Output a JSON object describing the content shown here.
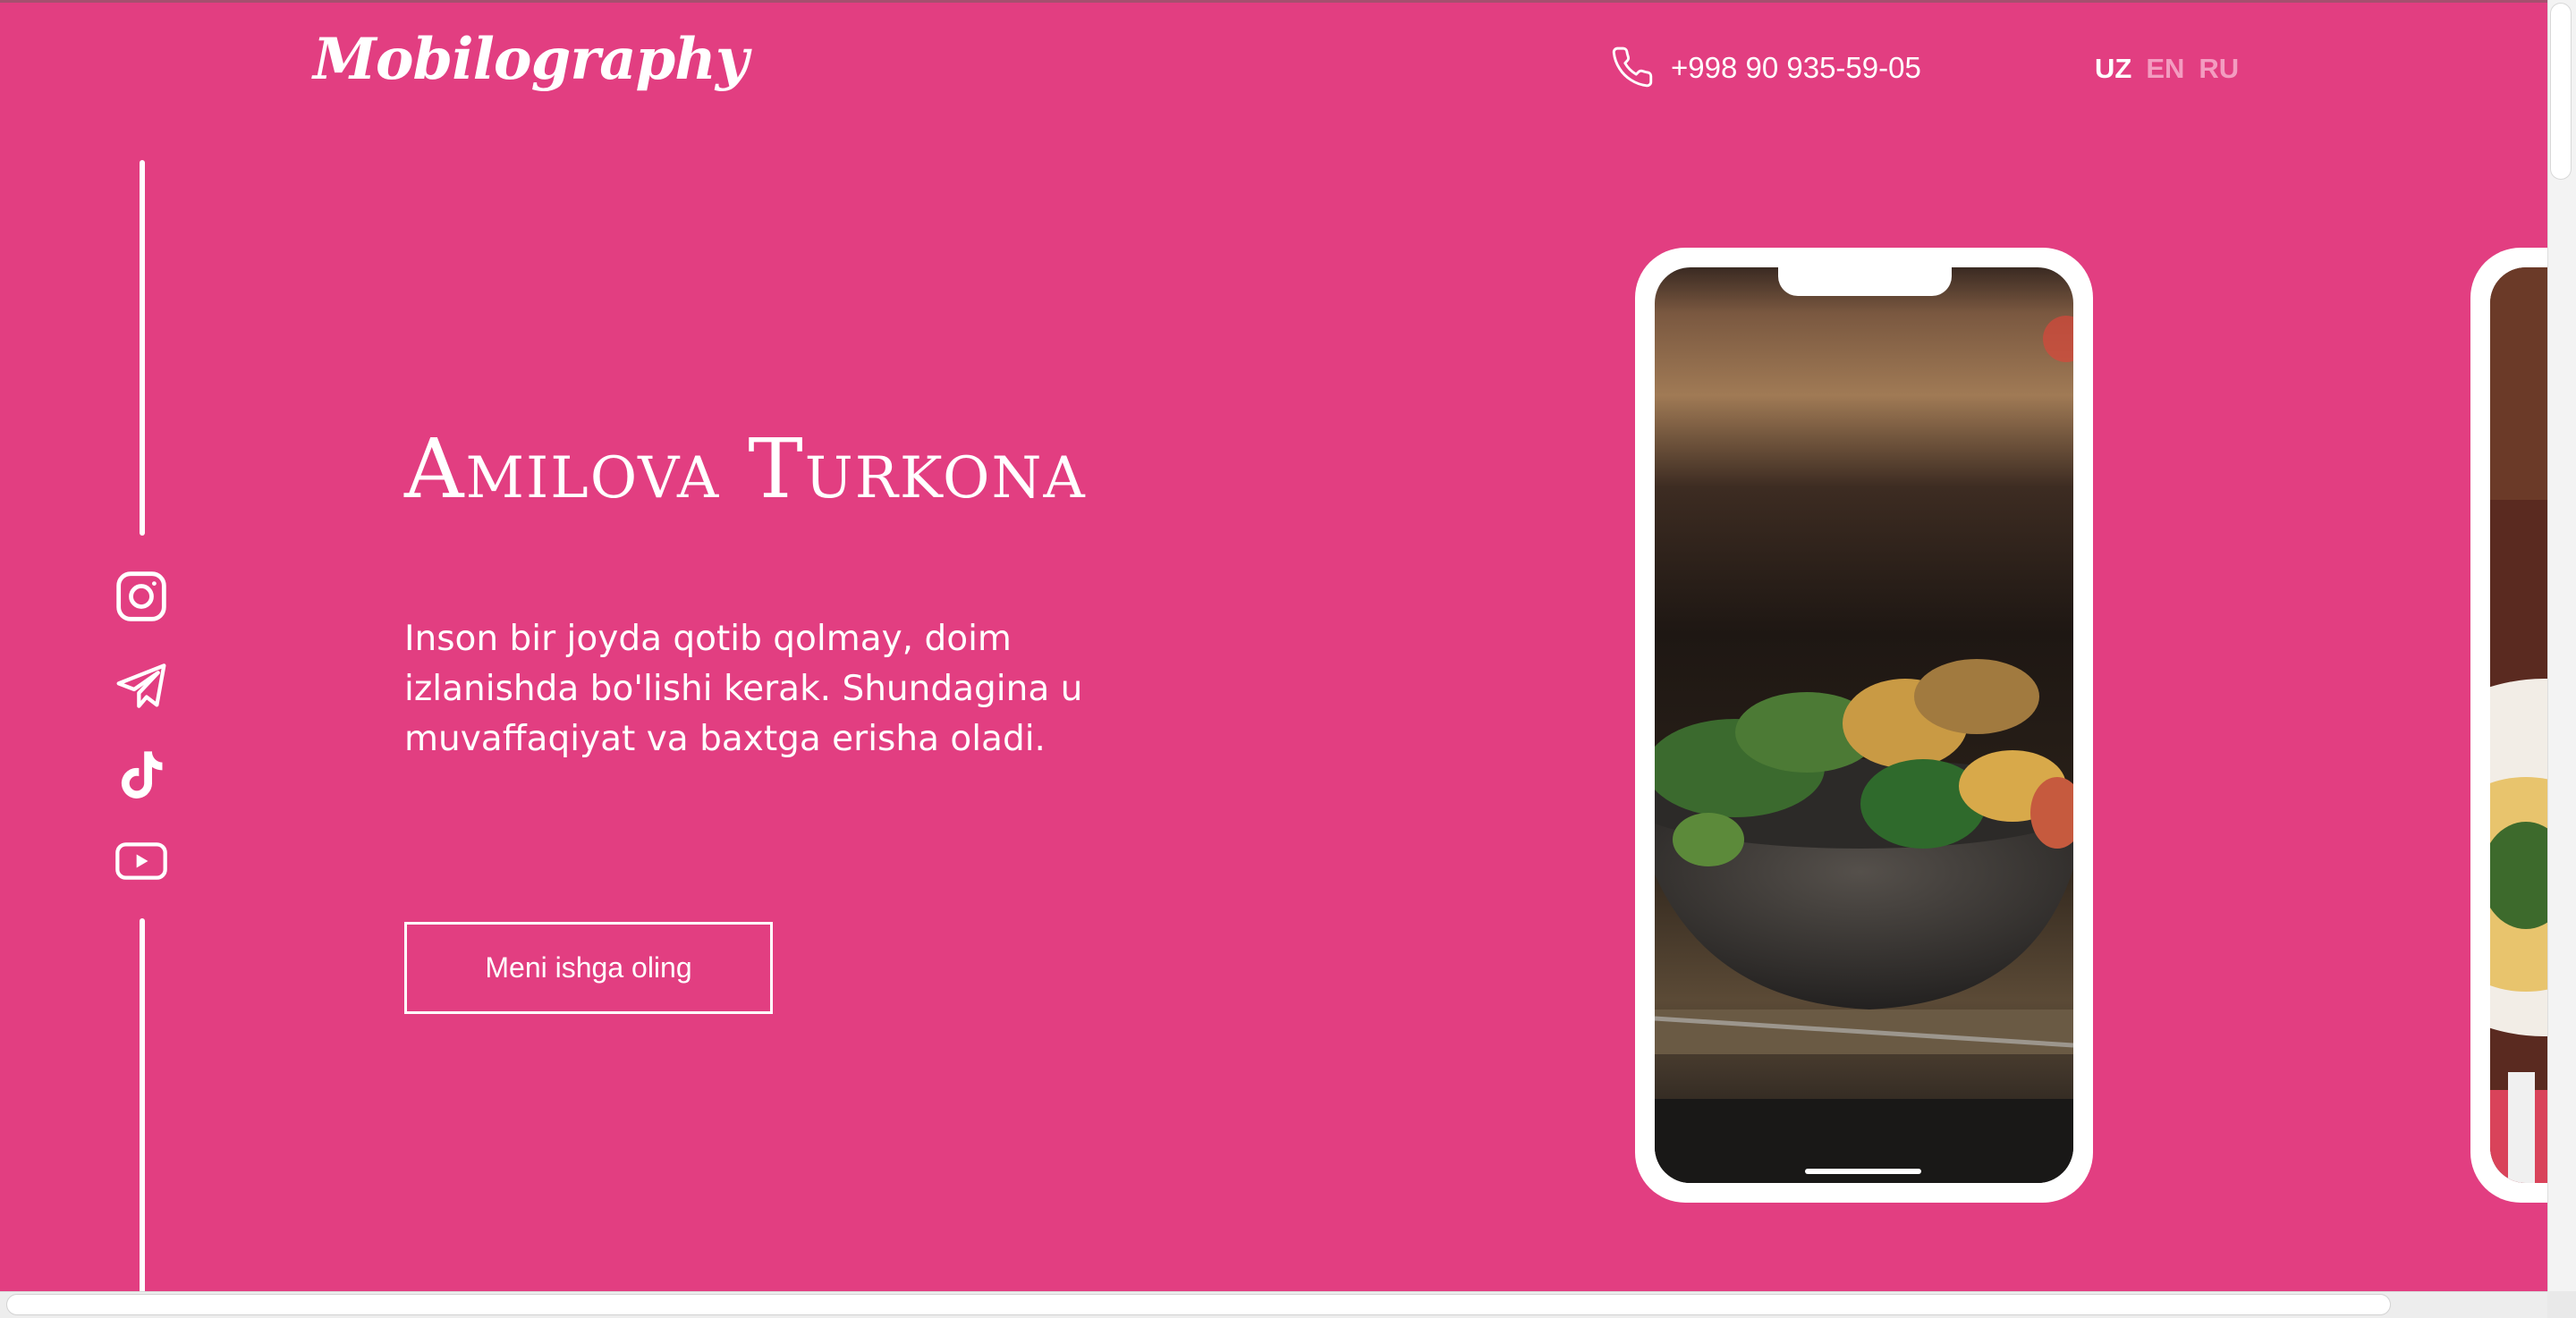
{
  "header": {
    "logo": "Mobilography",
    "phone": "+998 90 935-59-05",
    "languages": [
      {
        "code": "UZ",
        "active": true
      },
      {
        "code": "EN",
        "active": false
      },
      {
        "code": "RU",
        "active": false
      }
    ]
  },
  "social": {
    "icons": [
      "instagram-icon",
      "telegram-icon",
      "tiktok-icon",
      "youtube-icon"
    ]
  },
  "hero": {
    "title": "Amilova Turkona",
    "description": "Inson bir joyda qotib qolmay, doim izlanishda bo'lishi kerak. Shundagina u muvaffaqiyat va baxtga erisha oladi.",
    "cta": "Meni ishga oling"
  },
  "gallery": {
    "slides": [
      "food-salad-bowl-photo",
      "food-plate-photo"
    ]
  },
  "colors": {
    "background": "#e23e81",
    "text": "#ffffff",
    "inactive_lang": "#f39cc0"
  }
}
